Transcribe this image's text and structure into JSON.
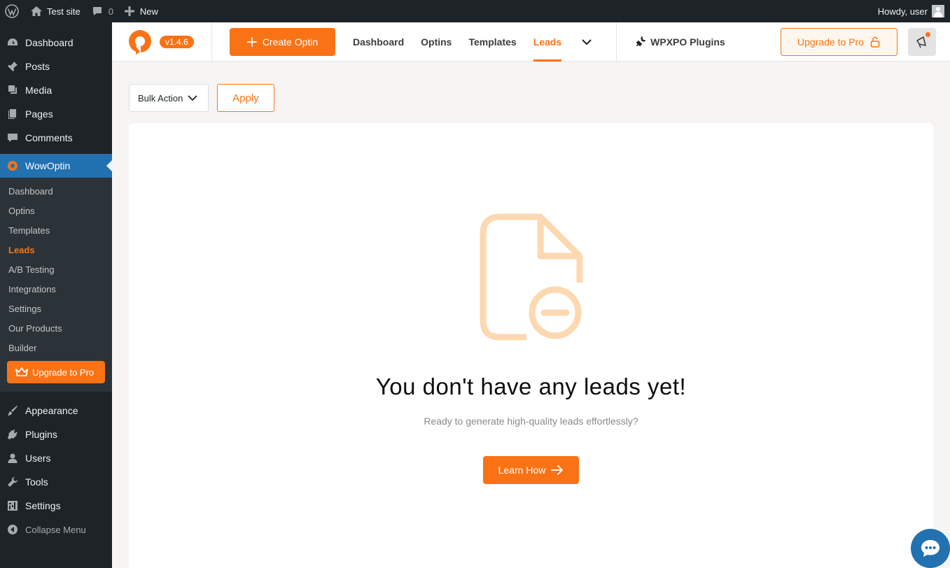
{
  "adminbar": {
    "site_name": "Test site",
    "comments_count": "0",
    "new_label": "New",
    "howdy": "Howdy, user"
  },
  "sidebar": {
    "items_top": [
      {
        "label": "Dashboard",
        "icon": "dashboard-icon"
      },
      {
        "label": "Posts",
        "icon": "pin-icon"
      },
      {
        "label": "Media",
        "icon": "media-icon"
      },
      {
        "label": "Pages",
        "icon": "pages-icon"
      },
      {
        "label": "Comments",
        "icon": "comment-icon"
      }
    ],
    "current": {
      "label": "WowOptin",
      "icon": "wowoptin-logo-icon"
    },
    "submenu": [
      "Dashboard",
      "Optins",
      "Templates",
      "Leads",
      "A/B Testing",
      "Integrations",
      "Settings",
      "Our Products",
      "Builder"
    ],
    "submenu_current": "Leads",
    "upgrade_label": "Upgrade to Pro",
    "items_bottom": [
      {
        "label": "Appearance",
        "icon": "brush-icon"
      },
      {
        "label": "Plugins",
        "icon": "plugin-icon"
      },
      {
        "label": "Users",
        "icon": "user-icon"
      },
      {
        "label": "Tools",
        "icon": "wrench-icon"
      },
      {
        "label": "Settings",
        "icon": "settings-icon"
      }
    ],
    "collapse_label": "Collapse Menu"
  },
  "topbar": {
    "version": "v1.4.6",
    "create_label": "Create Optin",
    "tabs": [
      "Dashboard",
      "Optins",
      "Templates",
      "Leads"
    ],
    "active_tab": "Leads",
    "wpxpo_label": "WPXPO Plugins",
    "upgrade_label": "Upgrade to Pro"
  },
  "toolbar": {
    "bulk_action": "Bulk Action",
    "apply_label": "Apply"
  },
  "empty_state": {
    "title": "You don't have any leads yet!",
    "subtitle": "Ready to generate high-quality leads effortlessly?",
    "button_label": "Learn How"
  },
  "colors": {
    "accent": "#f97316",
    "admin_bg": "#1d2327",
    "wp_blue": "#2271b1"
  }
}
